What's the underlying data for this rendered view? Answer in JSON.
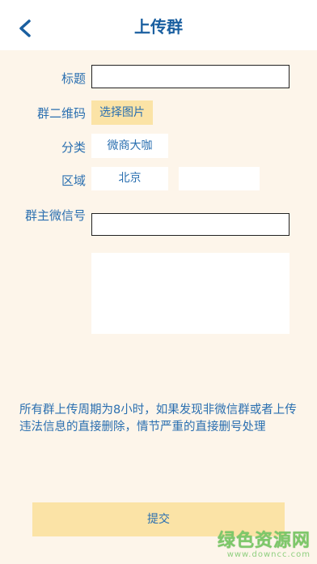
{
  "header": {
    "title": "上传群",
    "back_icon": "chevron-left-icon"
  },
  "form": {
    "title_label": "标题",
    "title_value": "",
    "qrcode_label": "群二维码",
    "qrcode_button": "选择图片",
    "category_label": "分类",
    "category_value": "微商大咖",
    "region_label": "区域",
    "region_value": "北京",
    "region_sub_value": "",
    "owner_wechat_label": "群主微信号",
    "owner_wechat_value": "",
    "description_value": ""
  },
  "notice": "所有群上传周期为8小时，如果发现非微信群或者上传违法信息的直接删除，情节严重的直接删号处理",
  "submit_label": "提交",
  "watermark": {
    "main": "绿色资源网",
    "sub": "www.downcc.com"
  },
  "colors": {
    "accent": "#2a6fb0",
    "button": "#fbe3a6",
    "background": "#fdf5ea"
  }
}
